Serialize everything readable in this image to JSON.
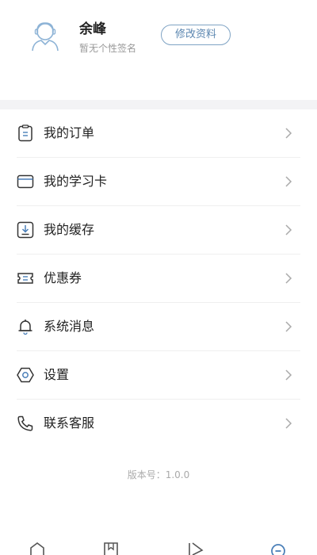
{
  "profile": {
    "name": "余峰",
    "signature": "暂无个性签名",
    "edit_label": "修改资料"
  },
  "menu": {
    "items": [
      {
        "label": "我的订单",
        "icon": "clipboard-icon"
      },
      {
        "label": "我的学习卡",
        "icon": "card-icon"
      },
      {
        "label": "我的缓存",
        "icon": "download-icon"
      },
      {
        "label": "优惠券",
        "icon": "ticket-icon"
      },
      {
        "label": "系统消息",
        "icon": "bell-icon"
      },
      {
        "label": "设置",
        "icon": "hexagon-settings-icon"
      },
      {
        "label": "联系客服",
        "icon": "phone-icon"
      }
    ]
  },
  "version": "版本号：1.0.0",
  "colors": {
    "accent": "#5b86b0",
    "active_tab": "#4a7fb8",
    "divider": "#efefef",
    "section_gap": "#f3f3f5"
  }
}
